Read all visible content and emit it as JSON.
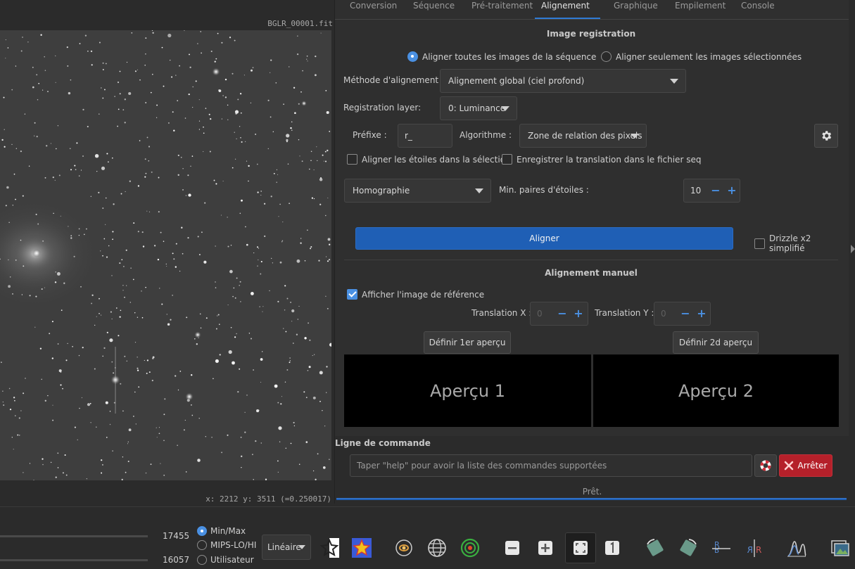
{
  "viewer": {
    "filename": "BGLR_00001.fit",
    "coords": "x: 2212 y: 3511 (=0.250017)"
  },
  "tabs": [
    "Conversion",
    "Séquence",
    "Pré-traitement",
    "Alignement",
    "Graphique",
    "Empilement",
    "Console"
  ],
  "registration": {
    "title": "Image registration",
    "radio_all": "Aligner toutes les images de la séquence",
    "radio_selected": "Aligner seulement les images sélectionnées",
    "method_label": "Méthode d'alignement :",
    "method_value": "Alignement global (ciel profond)",
    "layer_label": "Registration layer:",
    "layer_value": "0: Luminance",
    "prefix_label": "Préfixe :",
    "prefix_value": "r_",
    "algo_label": "Algorithme :",
    "algo_value": "Zone de relation des pixels",
    "check_stars": "Aligner les étoiles dans la sélection",
    "check_translation": "Enregistrer la translation dans le fichier seq",
    "transform_value": "Homographie",
    "minpairs_label": "Min. paires d'étoiles :",
    "minpairs_value": "10",
    "align_button": "Aligner",
    "drizzle_label": "Drizzle x2 simplifié"
  },
  "manual": {
    "title": "Alignement manuel",
    "show_ref": "Afficher l'image de référence",
    "tx_label": "Translation X :",
    "tx_value": "0",
    "ty_label": "Translation Y :",
    "ty_value": "0",
    "set_preview1": "Définir 1er aperçu",
    "set_preview2": "Définir 2d aperçu",
    "preview1": "Aperçu 1",
    "preview2": "Aperçu 2"
  },
  "command": {
    "title": "Ligne de commande",
    "placeholder": "Taper \"help\" pour avoir la liste des commandes supportées",
    "stop_button": "Arrêter",
    "status": "Prêt."
  },
  "toolbar": {
    "high_value": "17455",
    "low_value": "16057",
    "radio_minmax": "Min/Max",
    "radio_mips": "MIPS-LO/HI",
    "radio_user": "Utilisateur",
    "scale_value": "Linéaire"
  },
  "colors": {
    "accent": "#4a90e2",
    "primary_button": "#1f5fb5",
    "danger_button": "#b5202a"
  }
}
